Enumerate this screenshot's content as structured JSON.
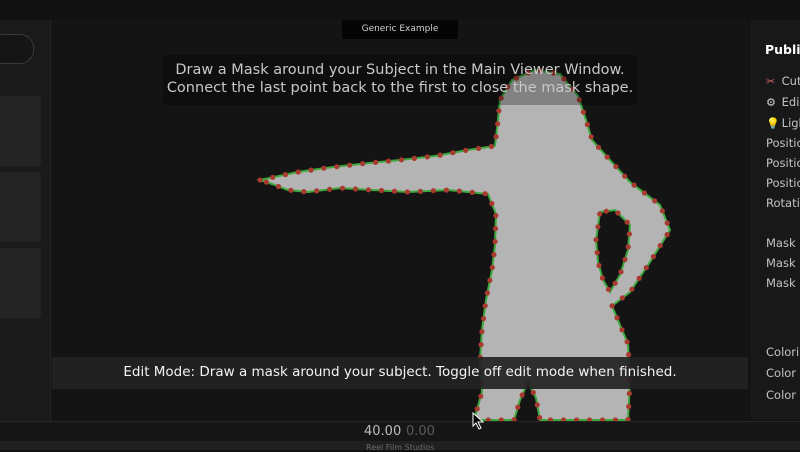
{
  "viewer": {
    "title": "Generic Example",
    "instruction_line1": "Draw a Mask around your Subject in the Main Viewer Window.",
    "instruction_line2": "Connect the last point back to the first to close the mask shape.",
    "edit_mode_message": "Edit Mode: Draw a mask around your subject. Toggle off edit mode when finished."
  },
  "right_panel": {
    "header": "Publis",
    "items": [
      {
        "icon": "scissors-icon",
        "glyph": "✂",
        "label": "Cut"
      },
      {
        "icon": "gear-icon",
        "glyph": "⚙",
        "label": "Edi"
      },
      {
        "icon": "lightbulb-icon",
        "glyph": "💡",
        "label": "Ligh"
      },
      {
        "label": "Positio"
      },
      {
        "label": "Positio"
      },
      {
        "label": "Positio"
      },
      {
        "label": "Rotatio"
      },
      {
        "label": "Mask S"
      },
      {
        "label": "Mask S"
      },
      {
        "label": "Mask S"
      },
      {
        "label": "Colori"
      },
      {
        "label": "Color"
      },
      {
        "label": "Color"
      }
    ]
  },
  "timeline": {
    "current": "40.00",
    "end": "0.00"
  },
  "status": {
    "text": "Reel Film Studios"
  },
  "colors": {
    "mask_fill": "#b4b4b4",
    "mask_outline": "#3ea83e",
    "mask_point": "#a83a30"
  }
}
